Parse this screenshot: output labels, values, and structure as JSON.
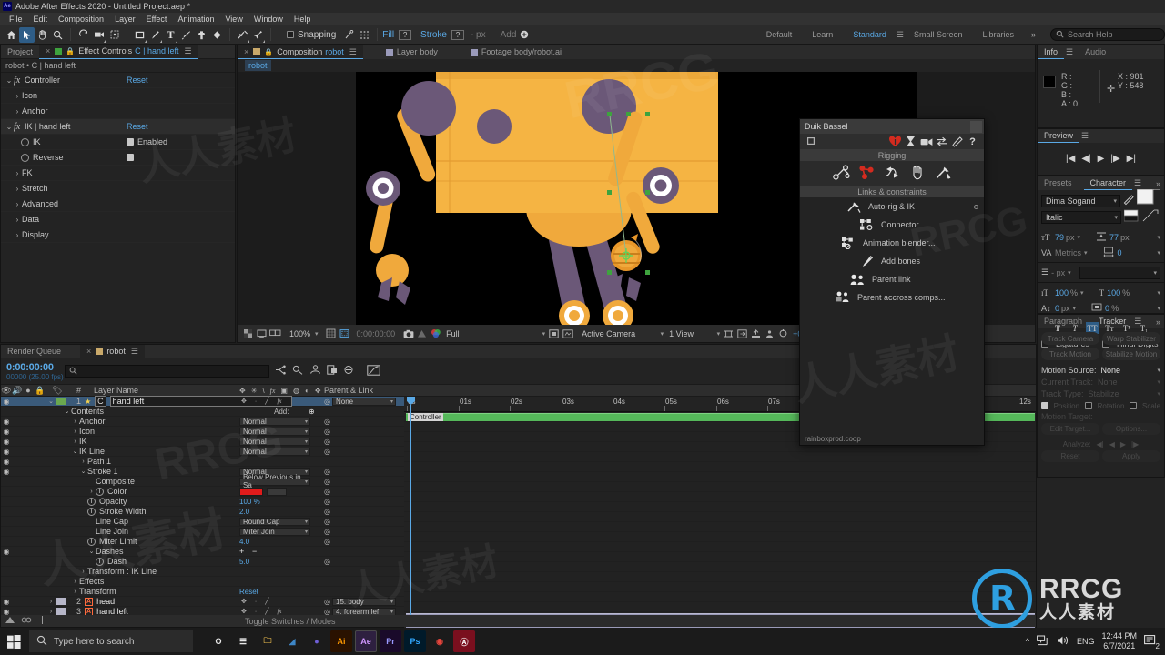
{
  "titlebar": {
    "app_title": "Adobe After Effects 2020 - Untitled Project.aep *",
    "logo": "Ae"
  },
  "menubar": {
    "items": [
      "File",
      "Edit",
      "Composition",
      "Layer",
      "Effect",
      "Animation",
      "View",
      "Window",
      "Help"
    ]
  },
  "toolbar": {
    "icons": [
      "home-icon",
      "selection-tool-icon",
      "hand-tool-icon",
      "zoom-tool-icon",
      "rotation-tool-icon",
      "camera-tool-icon",
      "anchor-point-tool-icon",
      "shape-tool-icon",
      "pen-tool-icon",
      "type-tool-icon",
      "brush-tool-icon",
      "clone-stamp-tool-icon",
      "eraser-tool-icon",
      "roto-brush-tool-icon",
      "puppet-pin-tool-icon"
    ],
    "snapping_label": "Snapping",
    "snapping_checked": false,
    "fill_label": "Fill",
    "fill_value": "?",
    "stroke_label": "Stroke",
    "stroke_value": "?",
    "stroke_units": "- px",
    "add_label": "Add",
    "workspaces": [
      "Default",
      "Learn",
      "Standard",
      "Small Screen",
      "Libraries"
    ],
    "workspace_selected": "Standard",
    "search_help_placeholder": "Search Help"
  },
  "effect_controls": {
    "tabs": [
      {
        "label": "Project",
        "selected": false
      },
      {
        "label": "Effect Controls",
        "name": "C | hand left",
        "selected": true
      }
    ],
    "breadcrumb": "robot • C | hand left",
    "rows": [
      {
        "indent": 0,
        "twirl": "v",
        "fx": true,
        "label": "Controller",
        "reset": "Reset"
      },
      {
        "indent": 1,
        "twirl": ">",
        "fx": false,
        "label": "Icon"
      },
      {
        "indent": 1,
        "twirl": ">",
        "fx": false,
        "label": "Anchor"
      },
      {
        "indent": 0,
        "twirl": "v",
        "fx": true,
        "label": "IK | hand left",
        "reset": "Reset",
        "highlight": true
      },
      {
        "indent": 2,
        "stopwatch": true,
        "label": "IK",
        "checkbox": true,
        "checkbox_label": "Enabled"
      },
      {
        "indent": 2,
        "stopwatch": true,
        "label": "Reverse",
        "checkbox": true
      },
      {
        "indent": 1,
        "twirl": ">",
        "label": "FK"
      },
      {
        "indent": 1,
        "twirl": ">",
        "label": "Stretch"
      },
      {
        "indent": 1,
        "twirl": ">",
        "label": "Advanced"
      },
      {
        "indent": 1,
        "twirl": ">",
        "label": "Data"
      },
      {
        "indent": 1,
        "twirl": ">",
        "label": "Display"
      }
    ]
  },
  "composition": {
    "tabs": [
      {
        "label": "Composition",
        "name": "robot",
        "selected": true
      },
      {
        "label": "Layer",
        "name": "body",
        "selected": false
      },
      {
        "label": "Footage",
        "name": "body/robot.ai",
        "selected": false
      }
    ],
    "breadcrumb": "robot",
    "toolbar": {
      "zoom": "100%",
      "time": "0:00:00:00",
      "resolution": "Full",
      "view": "Active Camera",
      "views": "1 View",
      "exposure": "+0.0"
    }
  },
  "info_panel": {
    "tabs": [
      "Info",
      "Audio"
    ],
    "selected": "Info",
    "channels": [
      {
        "k": "R :",
        "v": ""
      },
      {
        "k": "G :",
        "v": ""
      },
      {
        "k": "B :",
        "v": ""
      },
      {
        "k": "A :",
        "v": "0"
      }
    ],
    "x_label": "X :",
    "x_value": "981",
    "y_label": "Y :",
    "y_value": "548"
  },
  "preview_panel": {
    "title": "Preview",
    "buttons": [
      "first-frame",
      "prev-frame",
      "play",
      "next-frame",
      "last-frame"
    ]
  },
  "character_panel": {
    "tabs": [
      "Presets",
      "Character"
    ],
    "selected": "Character",
    "font_family": "Dima Sogand",
    "font_style": "Italic",
    "font_size": "79",
    "font_size_unit": "px",
    "leading": "77",
    "leading_unit": "px",
    "kerning_label": "Metrics",
    "tracking": "0",
    "stroke_width": "- px",
    "vertical_scale": "100",
    "vertical_scale_unit": "%",
    "horizontal_scale": "100",
    "horizontal_scale_unit": "%",
    "baseline_shift": "0",
    "baseline_shift_unit": "px",
    "tsume": "0",
    "tsume_unit": "%",
    "style_buttons": [
      "Bold",
      "Italic",
      "All Caps",
      "Small Caps",
      "Superscript",
      "Subscript"
    ],
    "style_active": "All Caps",
    "ligatures_label": "Ligatures",
    "ligatures_checked": false,
    "hindi_label": "Hindi Digits",
    "hindi_checked": false
  },
  "tracker_panel": {
    "tabs": [
      "Paragraph",
      "Tracker"
    ],
    "selected": "Tracker",
    "buttons": [
      "Track Camera",
      "Warp Stabilizer",
      "Track Motion",
      "Stabilize Motion"
    ],
    "motion_source_label": "Motion Source:",
    "motion_source_value": "None",
    "current_track_label": "Current Track:",
    "current_track_value": "None",
    "track_type_label": "Track Type:",
    "track_type_value": "Stabilize",
    "position_label": "Position",
    "position_checked": true,
    "rotation_label": "Rotation",
    "rotation_checked": false,
    "scale_label": "Scale",
    "scale_checked": false,
    "motion_target_label": "Motion Target:",
    "edit_target_label": "Edit Target...",
    "options_label": "Options...",
    "analyze_label": "Analyze:",
    "reset_label": "Reset",
    "apply_label": "Apply"
  },
  "timeline": {
    "tabs": [
      {
        "label": "Render Queue",
        "selected": false
      },
      {
        "label": "robot",
        "selected": true
      }
    ],
    "current_time": "0:00:00:00",
    "frame_rate": "00000 (25.00 fps)",
    "search_placeholder": "",
    "columns": [
      "#",
      "Layer Name",
      "Parent & Link"
    ],
    "toggle_switches_label": "Toggle Switches / Modes",
    "ruler_labels": [
      "0s",
      "01s",
      "02s",
      "03s",
      "04s",
      "05s",
      "06s",
      "07s",
      "12s"
    ],
    "bar_label": "Controller",
    "rows": [
      {
        "idx": "1",
        "name": "hand left",
        "prefix": "C",
        "selected": true,
        "eye": true,
        "star": true,
        "link": "None",
        "indent": 0,
        "kind": "layer"
      },
      {
        "name": "Contents",
        "twirl": "v",
        "indent": 2,
        "add": "Add:",
        "kind": "group"
      },
      {
        "name": "Anchor",
        "twirl": ">",
        "indent": 3,
        "mode": "Normal",
        "eye": true,
        "kind": "group"
      },
      {
        "name": "Icon",
        "twirl": ">",
        "indent": 3,
        "mode": "Normal",
        "eye": true,
        "kind": "group"
      },
      {
        "name": "IK",
        "twirl": ">",
        "indent": 3,
        "mode": "Normal",
        "eye": true,
        "kind": "group"
      },
      {
        "name": "IK Line",
        "twirl": "v",
        "indent": 3,
        "mode": "Normal",
        "eye": true,
        "kind": "group"
      },
      {
        "name": "Path 1",
        "twirl": ">",
        "indent": 4,
        "eye": true,
        "kind": "path"
      },
      {
        "name": "Stroke 1",
        "twirl": "v",
        "indent": 4,
        "mode": "Normal",
        "eye": true,
        "kind": "group"
      },
      {
        "name": "Composite",
        "indent": 6,
        "mode": "Below Previous in Sa",
        "kind": "prop"
      },
      {
        "name": "Color",
        "twirl": ">",
        "indent": 5,
        "stopwatch": true,
        "swatch": "#e01b1b",
        "kind": "prop"
      },
      {
        "name": "Opacity",
        "indent": 5,
        "stopwatch": true,
        "value": "100 %",
        "kind": "prop"
      },
      {
        "name": "Stroke Width",
        "indent": 5,
        "stopwatch": true,
        "value": "2.0",
        "kind": "prop"
      },
      {
        "name": "Line Cap",
        "indent": 6,
        "mode": "Round Cap",
        "kind": "prop"
      },
      {
        "name": "Line Join",
        "indent": 6,
        "mode": "Miter Join",
        "kind": "prop"
      },
      {
        "name": "Miter Limit",
        "indent": 5,
        "stopwatch": true,
        "value": "4.0",
        "kind": "prop"
      },
      {
        "name": "Dashes",
        "twirl": "v",
        "indent": 5,
        "plusminus": true,
        "eye": true,
        "kind": "group"
      },
      {
        "name": "Dash",
        "indent": 6,
        "stopwatch": true,
        "value": "5.0",
        "kind": "prop"
      },
      {
        "name": "Transform : IK Line",
        "twirl": ">",
        "indent": 4,
        "kind": "group"
      },
      {
        "name": "Effects",
        "twirl": ">",
        "indent": 3,
        "kind": "group"
      },
      {
        "name": "Transform",
        "twirl": ">",
        "indent": 3,
        "reset": "Reset",
        "kind": "group"
      },
      {
        "idx": "2",
        "name": "head",
        "indent": 0,
        "eye": true,
        "ai": true,
        "link": "15. body",
        "kind": "layer"
      },
      {
        "idx": "3",
        "name": "hand left",
        "indent": 0,
        "eye": true,
        "ai": true,
        "link": "4. forearm lef",
        "kind": "layer"
      }
    ]
  },
  "duik": {
    "title": "Duik Bassel",
    "footer": "rainboxprod.coop",
    "toolbar_icons": [
      "duik-logo-icon",
      "rendering-icon",
      "camera-icon",
      "transfer-icon",
      "settings-icon",
      "help-icon"
    ],
    "sections": [
      {
        "title": "Rigging",
        "icons": [
          "structure-icon",
          "links-icon",
          "automation-icon",
          "animation-icon",
          "tools-icon"
        ]
      },
      {
        "title": "Links & constraints",
        "items": [
          {
            "label": "Auto-rig & IK",
            "icon": "autorig-icon",
            "has_options": true
          },
          {
            "label": "Connector...",
            "icon": "connector-icon"
          },
          {
            "label": "Animation blender...",
            "icon": "blender-icon"
          },
          {
            "label": "Add bones",
            "icon": "bone-icon"
          },
          {
            "label": "Parent link",
            "icon": "parent-link-icon"
          },
          {
            "label": "Parent accross comps...",
            "icon": "parent-comps-icon"
          }
        ]
      }
    ]
  },
  "taskbar": {
    "search_placeholder": "Type here to search",
    "apps": [
      {
        "name": "cortana-icon",
        "label": "O",
        "bg": "transparent",
        "fg": "#e8e8e8"
      },
      {
        "name": "task-view-icon",
        "label": "☰",
        "bg": "transparent",
        "fg": "#e8e8e8"
      },
      {
        "name": "file-explorer-icon",
        "label": "🗀",
        "bg": "transparent",
        "fg": "#f2c14e"
      },
      {
        "name": "media-icon",
        "label": "◢",
        "bg": "transparent",
        "fg": "#3d86c6"
      },
      {
        "name": "browser-icon",
        "label": "●",
        "bg": "transparent",
        "fg": "#6f5fd6"
      },
      {
        "name": "illustrator-icon",
        "label": "Ai",
        "bg": "#2a1200",
        "fg": "#ff9a00"
      },
      {
        "name": "after-effects-icon",
        "label": "Ae",
        "bg": "#2a1a3a",
        "fg": "#cf96fd"
      },
      {
        "name": "premiere-icon",
        "label": "Pr",
        "bg": "#1a0a2a",
        "fg": "#9a9aff"
      },
      {
        "name": "photoshop-icon",
        "label": "Ps",
        "bg": "#001a2a",
        "fg": "#31a8ff"
      },
      {
        "name": "chrome-icon",
        "label": "◉",
        "bg": "transparent",
        "fg": "#e8453c"
      },
      {
        "name": "recorder-icon",
        "label": "Ⓐ",
        "bg": "#7a0f1e",
        "fg": "#ffffff"
      }
    ],
    "lang": "ENG",
    "time": "12:44 PM",
    "date": "6/7/2021",
    "notification_count": "2"
  },
  "watermark": {
    "brand": "RRCG",
    "brand_cn": "人人素材"
  },
  "colors": {
    "accent_blue": "#5aa9e6",
    "duik_red": "#d42b1f",
    "robot_body": "#f0a93c",
    "robot_joint": "#6b5878",
    "timeline_bar": "#55b85a"
  }
}
